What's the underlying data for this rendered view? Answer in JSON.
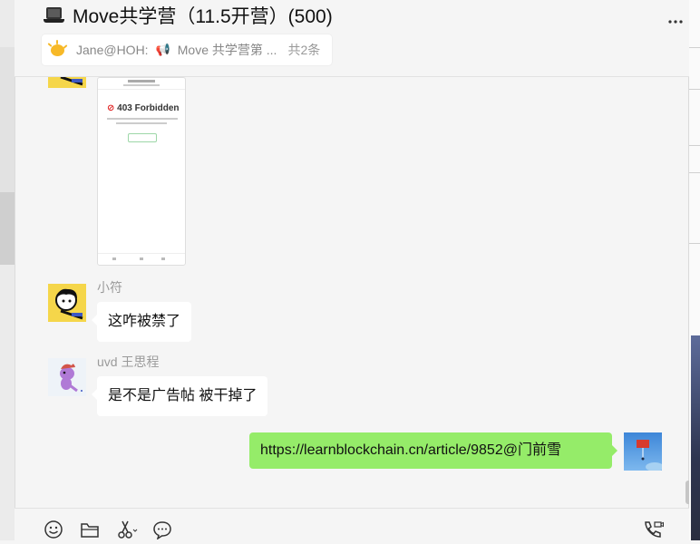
{
  "header": {
    "title": "Move共学营（11.5开营）(500)",
    "title_icon": "laptop-icon",
    "more_icon": "more-icon"
  },
  "pinned": {
    "sender": "Jane@HOH:",
    "preview": "Move 共学营第 ...",
    "count": "共2条",
    "icon": "sun-icon"
  },
  "shared_image": {
    "error_text": "403 Forbidden"
  },
  "messages": [
    {
      "sender": "小符",
      "text": "这咋被禁了",
      "avatar": "yellow-cartoon"
    },
    {
      "sender": "uvd 王思程",
      "text": "是不是广告帖  被干掉了",
      "avatar": "purple-dino"
    },
    {
      "sender": "",
      "text": "https://learnblockchain.cn/article/9852@门前雪",
      "avatar": "sky-flag",
      "mine": true
    }
  ],
  "toolbar": {
    "icons": [
      "emoji-icon",
      "folder-icon",
      "scissors-icon",
      "chat-bubble-icon",
      "voice-video-call-icon"
    ]
  },
  "colors": {
    "background": "#f5f5f5",
    "bubble_mine": "#95ec69",
    "bubble_other": "#ffffff",
    "sender_name": "#9a9a9a"
  }
}
